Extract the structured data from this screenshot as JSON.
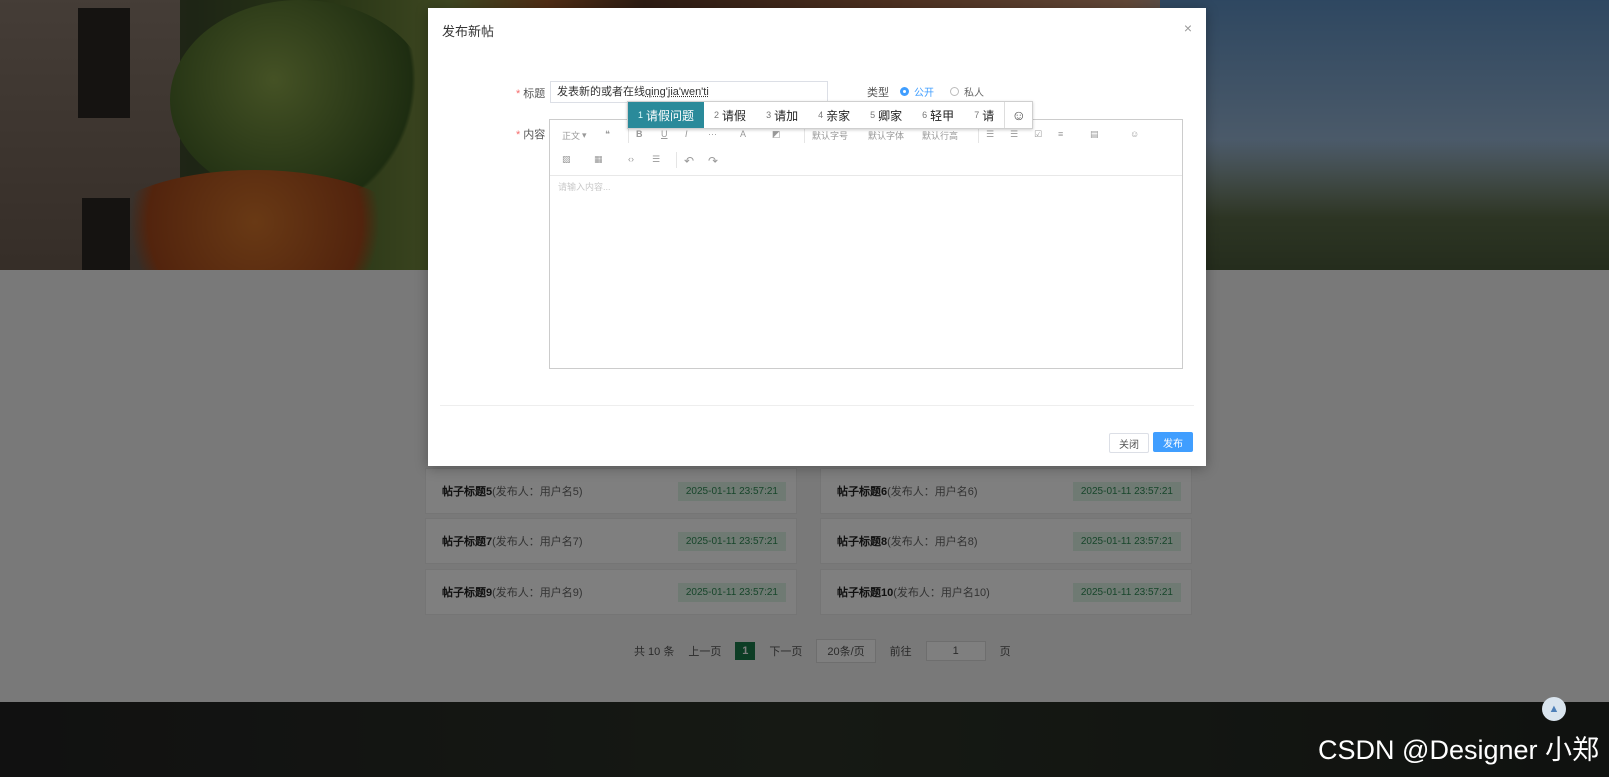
{
  "modal": {
    "title": "发布新帖",
    "close_icon": "×",
    "form": {
      "title_label": "标题",
      "title_value_text": "发表新的",
      "title_value_after_cursor": "或者在线",
      "title_value_pinyin": "qing'jia'wen'ti",
      "type_label": "类型",
      "type_options": [
        {
          "label": "公开",
          "selected": true
        },
        {
          "label": "私人",
          "selected": false
        }
      ],
      "content_label": "内容",
      "editor_placeholder": "请输入内容...",
      "toolbar_row1": [
        "正文",
        "❝",
        "B",
        "U",
        "I",
        "···",
        "A",
        "◩",
        "默认字号",
        "默认字体",
        "默认行高",
        "☰",
        "☰",
        "☑",
        "≡",
        "▤",
        "☺"
      ],
      "toolbar_row2": [
        "▨",
        "▦",
        "‹›",
        "☰",
        "↶",
        "↷"
      ]
    },
    "ime_candidates": [
      {
        "n": "1",
        "text": "请假问题"
      },
      {
        "n": "2",
        "text": "请假"
      },
      {
        "n": "3",
        "text": "请加"
      },
      {
        "n": "4",
        "text": "亲家"
      },
      {
        "n": "5",
        "text": "卿家"
      },
      {
        "n": "6",
        "text": "轻甲"
      },
      {
        "n": "7",
        "text": "请"
      }
    ],
    "ime_emoji": "☺",
    "close_button": "关闭",
    "publish_button": "发布"
  },
  "posts": [
    {
      "title": "帖子标题5",
      "by": "(发布人：用户名5)",
      "time": "2025-01-11 23:57:21"
    },
    {
      "title": "帖子标题6",
      "by": "(发布人：用户名6)",
      "time": "2025-01-11 23:57:21"
    },
    {
      "title": "帖子标题7",
      "by": "(发布人：用户名7)",
      "time": "2025-01-11 23:57:21"
    },
    {
      "title": "帖子标题8",
      "by": "(发布人：用户名8)",
      "time": "2025-01-11 23:57:21"
    },
    {
      "title": "帖子标题9",
      "by": "(发布人：用户名9)",
      "time": "2025-01-11 23:57:21"
    },
    {
      "title": "帖子标题10",
      "by": "(发布人：用户名10)",
      "time": "2025-01-11 23:57:21"
    }
  ],
  "pager": {
    "total": "共 10 条",
    "prev": "上一页",
    "current": "1",
    "next": "下一页",
    "size": "20条/页",
    "goto": "前往",
    "goto_value": "1",
    "page_unit": "页"
  },
  "back_top_icon": "▲",
  "watermark": "CSDN @Designer 小郑",
  "colors": {
    "accent": "#409eff",
    "ime_selected": "#2a8a9a",
    "pager_active": "#1a7a4a",
    "time_badge": "#dff5e7"
  }
}
